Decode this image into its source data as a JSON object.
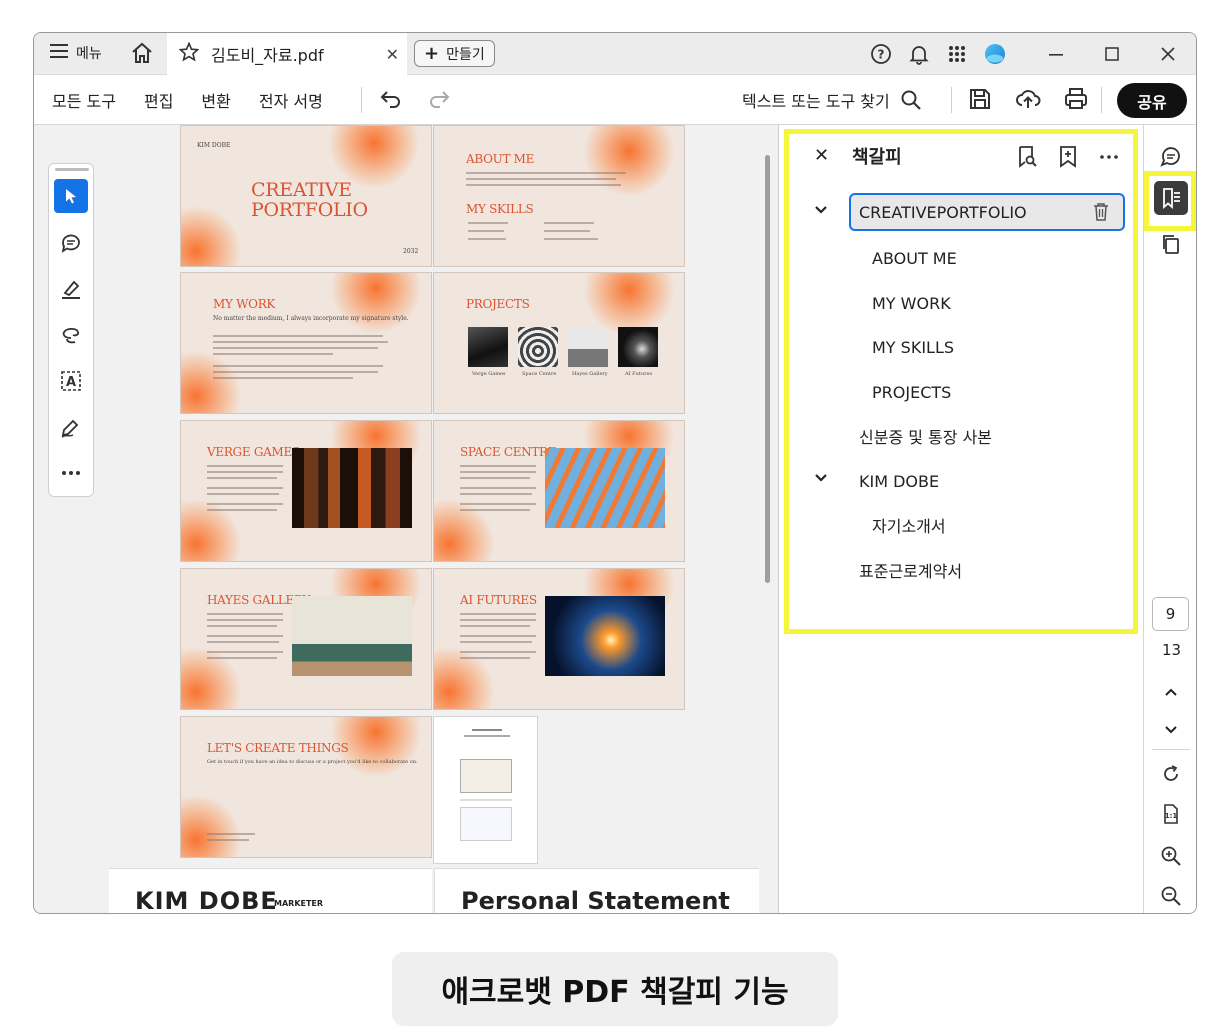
{
  "titlebar": {
    "menu_label": "메뉴",
    "tab_title": "김도비_자료.pdf",
    "new_label": "만들기"
  },
  "toolbar": {
    "items": [
      "모든 도구",
      "편집",
      "변환",
      "전자 서명"
    ],
    "search_label": "텍스트 또는 도구 찾기",
    "share_label": "공유"
  },
  "pages": {
    "thumbs": [
      {
        "title": "CREATIVE\nPORTFOLIO",
        "author": "KIM DOBE",
        "year": "2032"
      },
      {
        "title": "ABOUT ME",
        "sub": "MY SKILLS"
      },
      {
        "title": "MY WORK",
        "sub": "No matter the medium, I always incorporate my signature style."
      },
      {
        "title": "PROJECTS",
        "captions": [
          "Verge Games",
          "Space Centre",
          "Hayes Gallery",
          "AI Futures"
        ]
      },
      {
        "title": "VERGE GAMES"
      },
      {
        "title": "SPACE CENTRE"
      },
      {
        "title": "HAYES GALLERY"
      },
      {
        "title": "AI FUTURES"
      },
      {
        "title": "LET'S CREATE THINGS",
        "sub": "Get in touch if you have an idea to discuss or a project you'd like to collaborate on."
      }
    ],
    "bottom_left_name": "KIM DOBE",
    "bottom_left_role": "MARKETER",
    "bottom_right_title": "Personal Statement"
  },
  "bookmarks": {
    "title": "책갈피",
    "items": [
      {
        "label": "CREATIVEPORTFOLIO",
        "level": 0,
        "expanded": true,
        "selected": true
      },
      {
        "label": "ABOUT ME",
        "level": 1
      },
      {
        "label": "MY WORK",
        "level": 1
      },
      {
        "label": "MY SKILLS",
        "level": 1
      },
      {
        "label": "PROJECTS",
        "level": 1
      },
      {
        "label": "신분증 및 통장 사본",
        "level": 0
      },
      {
        "label": "KIM DOBE",
        "level": 0,
        "expanded": true
      },
      {
        "label": "자기소개서",
        "level": 1
      },
      {
        "label": "표준근로계약서",
        "level": 0
      }
    ]
  },
  "rail": {
    "current_page": "9",
    "total_pages": "13"
  },
  "caption": "애크로뱃 PDF 책갈피 기능",
  "colors": {
    "accent": "#1473e6",
    "highlight": "#f5f53a",
    "thumb_bg": "#f1e6de",
    "thumb_title": "#d85533"
  }
}
